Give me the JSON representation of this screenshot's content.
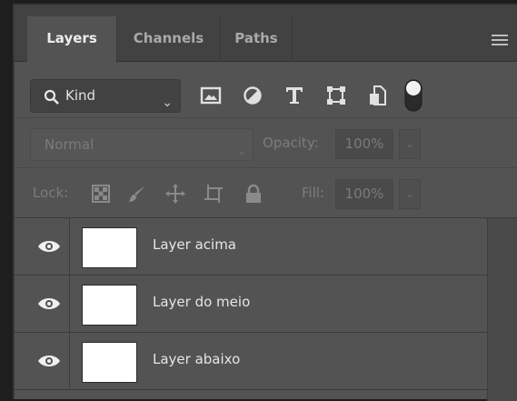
{
  "tabs": [
    {
      "label": "Layers",
      "active": true
    },
    {
      "label": "Channels",
      "active": false
    },
    {
      "label": "Paths",
      "active": false
    }
  ],
  "filter": {
    "kind_label": "Kind",
    "icons": [
      "image-filter-icon",
      "adjustment-filter-icon",
      "type-filter-icon",
      "shape-filter-icon",
      "smart-object-filter-icon",
      "filter-toggle-icon"
    ]
  },
  "blend": {
    "mode": "Normal",
    "opacity_label": "Opacity:",
    "opacity_value": "100%",
    "fill_label": "Fill:",
    "fill_value": "100%"
  },
  "lock": {
    "label": "Lock:"
  },
  "layers": [
    {
      "name": "Layer acima",
      "visible": true
    },
    {
      "name": "Layer do meio",
      "visible": true
    },
    {
      "name": "Layer abaixo",
      "visible": true
    }
  ],
  "colors": {
    "panel": "#535353",
    "tabbar": "#424242",
    "text": "#e6e6e6",
    "dim_text": "#7c7c7c"
  }
}
